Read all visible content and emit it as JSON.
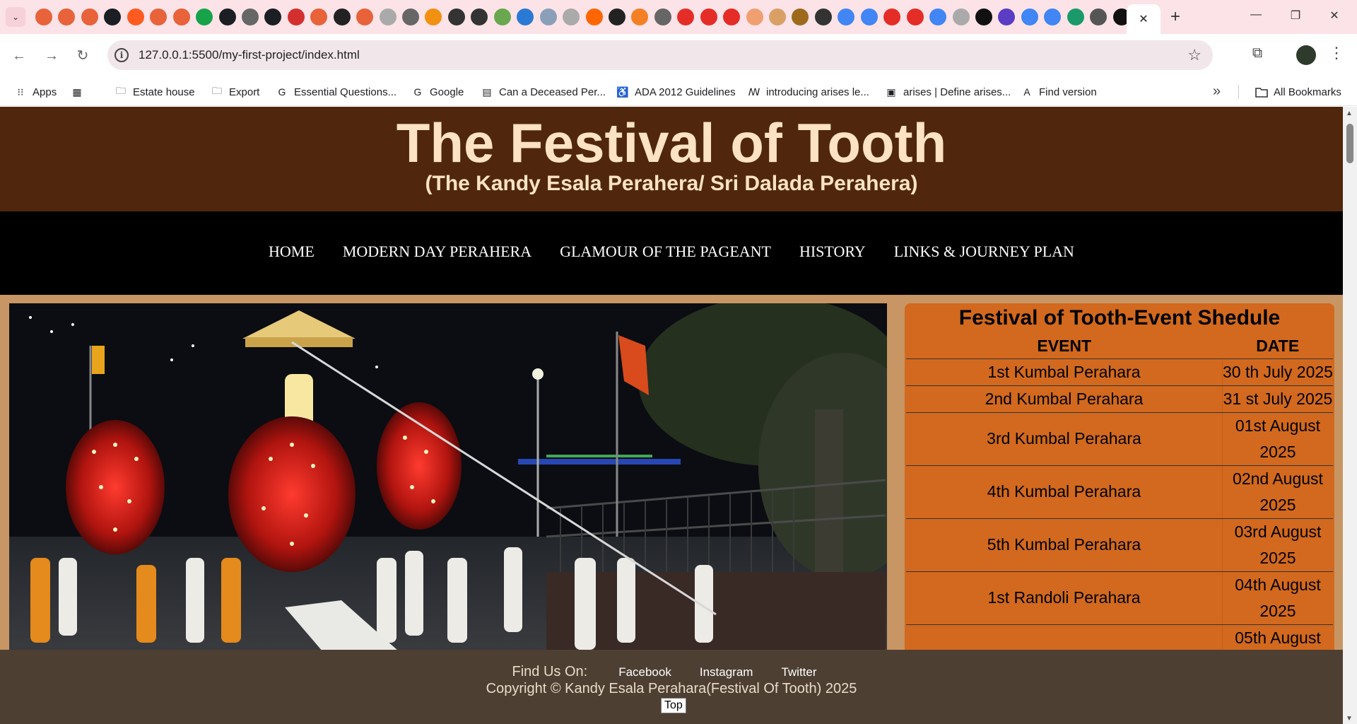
{
  "browser": {
    "tab_favicons": [
      {
        "icon": "target-icon",
        "color": "#e8623a"
      },
      {
        "icon": "target-icon",
        "color": "#e8623a"
      },
      {
        "icon": "target-icon",
        "color": "#e8623a"
      },
      {
        "icon": "github-icon",
        "color": "#1b1f23"
      },
      {
        "icon": "record-icon",
        "color": "#ff5a1f"
      },
      {
        "icon": "target-icon",
        "color": "#e8623a"
      },
      {
        "icon": "target-icon",
        "color": "#e8623a"
      },
      {
        "icon": "d-icon",
        "color": "#17a34a"
      },
      {
        "icon": "github-icon",
        "color": "#1b1f23"
      },
      {
        "icon": "globe-icon",
        "color": "#666666"
      },
      {
        "icon": "github-icon",
        "color": "#1b1f23"
      },
      {
        "icon": "pdf-icon",
        "color": "#d32f2f"
      },
      {
        "icon": "target-icon",
        "color": "#e8623a"
      },
      {
        "icon": "sigma-icon",
        "color": "#222222"
      },
      {
        "icon": "target-icon",
        "color": "#e8623a"
      },
      {
        "icon": "google-icon",
        "color": "#aaaaaa"
      },
      {
        "icon": "globe-icon",
        "color": "#666666"
      },
      {
        "icon": "puzzle-icon",
        "color": "#f29111"
      },
      {
        "icon": "openai-icon",
        "color": "#333333"
      },
      {
        "icon": "openai-icon",
        "color": "#333333"
      },
      {
        "icon": "leaf-icon",
        "color": "#6aa84f"
      },
      {
        "icon": "square-icon",
        "color": "#2a79d4"
      },
      {
        "icon": "cloud-icon",
        "color": "#8aa0b8"
      },
      {
        "icon": "google-icon",
        "color": "#aaaaaa"
      },
      {
        "icon": "y-icon",
        "color": "#ff6600"
      },
      {
        "icon": "paw-icon",
        "color": "#222222"
      },
      {
        "icon": "fox-icon",
        "color": "#f48024"
      },
      {
        "icon": "globe-icon",
        "color": "#666666"
      },
      {
        "icon": "youtube-icon",
        "color": "#e52d27"
      },
      {
        "icon": "youtube-icon",
        "color": "#e52d27"
      },
      {
        "icon": "youtube-icon",
        "color": "#e52d27"
      },
      {
        "icon": "dial-icon",
        "color": "#f0a070"
      },
      {
        "icon": "cake-icon",
        "color": "#d9a066"
      },
      {
        "icon": "coin-icon",
        "color": "#9c6a1a"
      },
      {
        "icon": "wikipedia-icon",
        "color": "#333333"
      },
      {
        "icon": "google-icon",
        "color": "#4285f4"
      },
      {
        "icon": "google-icon",
        "color": "#4285f4"
      },
      {
        "icon": "youtube-icon",
        "color": "#e52d27"
      },
      {
        "icon": "youtube-icon",
        "color": "#e52d27"
      },
      {
        "icon": "google-icon",
        "color": "#4285f4"
      },
      {
        "icon": "google-icon",
        "color": "#aaaaaa"
      },
      {
        "icon": "openai-icon",
        "color": "#111111"
      },
      {
        "icon": "b-icon",
        "color": "#5b3cc4"
      },
      {
        "icon": "gemini-icon",
        "color": "#4285f4"
      },
      {
        "icon": "google-icon",
        "color": "#4285f4"
      },
      {
        "icon": "w-icon",
        "color": "#1a9a6a"
      },
      {
        "icon": "w-icon",
        "color": "#555555"
      },
      {
        "icon": "notion-icon",
        "color": "#111111"
      }
    ],
    "active_tab_close": "✕",
    "new_tab": "+",
    "window_controls": {
      "minimize": "—",
      "maximize": "❐",
      "close": "✕"
    },
    "url": "127.0.0.1:5500/my-first-project/index.html",
    "bookmarks": [
      {
        "label": "Apps",
        "icon": "apps-grid-icon"
      },
      {
        "label": "",
        "icon": "tab-groups-icon"
      },
      {
        "label": "Estate house",
        "icon": "folder-icon"
      },
      {
        "label": "Export",
        "icon": "folder-icon"
      },
      {
        "label": "Essential Questions...",
        "icon": "google-icon"
      },
      {
        "label": "Google",
        "icon": "google-icon"
      },
      {
        "label": "Can a Deceased Per...",
        "icon": "document-icon"
      },
      {
        "label": "ADA 2012 Guidelines",
        "icon": "ada-icon"
      },
      {
        "label": "introducing arises le...",
        "icon": "mw-icon"
      },
      {
        "label": "arises | Define arises...",
        "icon": "dictionary-icon"
      },
      {
        "label": "Find version",
        "icon": "adobe-icon"
      }
    ],
    "all_bookmarks": "All Bookmarks"
  },
  "site": {
    "title": "The Festival of Tooth",
    "subtitle": "(The Kandy Esala Perahera/ Sri Dalada Perahera)",
    "nav": [
      "HOME",
      "MODERN DAY PERAHERA",
      "GLAMOUR OF THE PAGEANT",
      "HISTORY",
      "LINKS & JOURNEY PLAN"
    ],
    "schedule": {
      "title": "Festival of Tooth-Event Shedule",
      "headers": [
        "EVENT",
        "DATE"
      ],
      "rows": [
        {
          "event": "1st Kumbal Perahara",
          "date": "30 th July 2025"
        },
        {
          "event": "2nd Kumbal Perahara",
          "date": "31 st July 2025"
        },
        {
          "event": "3rd Kumbal Perahara",
          "date": "01st August 2025"
        },
        {
          "event": "4th Kumbal Perahara",
          "date": "02nd August 2025"
        },
        {
          "event": "5th Kumbal Perahara",
          "date": "03rd August 2025"
        },
        {
          "event": "1st Randoli Perahara",
          "date": "04th August 2025"
        },
        {
          "event": "",
          "date": "05th August"
        }
      ]
    },
    "footer": {
      "find_us": "Find Us On:",
      "social": [
        "Facebook",
        "Instagram",
        "Twitter"
      ],
      "copyright": "Copyright © Kandy Esala Perahara(Festival Of Tooth) 2025",
      "top_button": "Top"
    },
    "colors": {
      "header_bg": "#50270d",
      "title_color": "#fde3c3",
      "nav_bg": "#000000",
      "page_bg": "#c89664",
      "schedule_bg": "#d2691e",
      "footer_bg": "#4e3f33"
    }
  }
}
